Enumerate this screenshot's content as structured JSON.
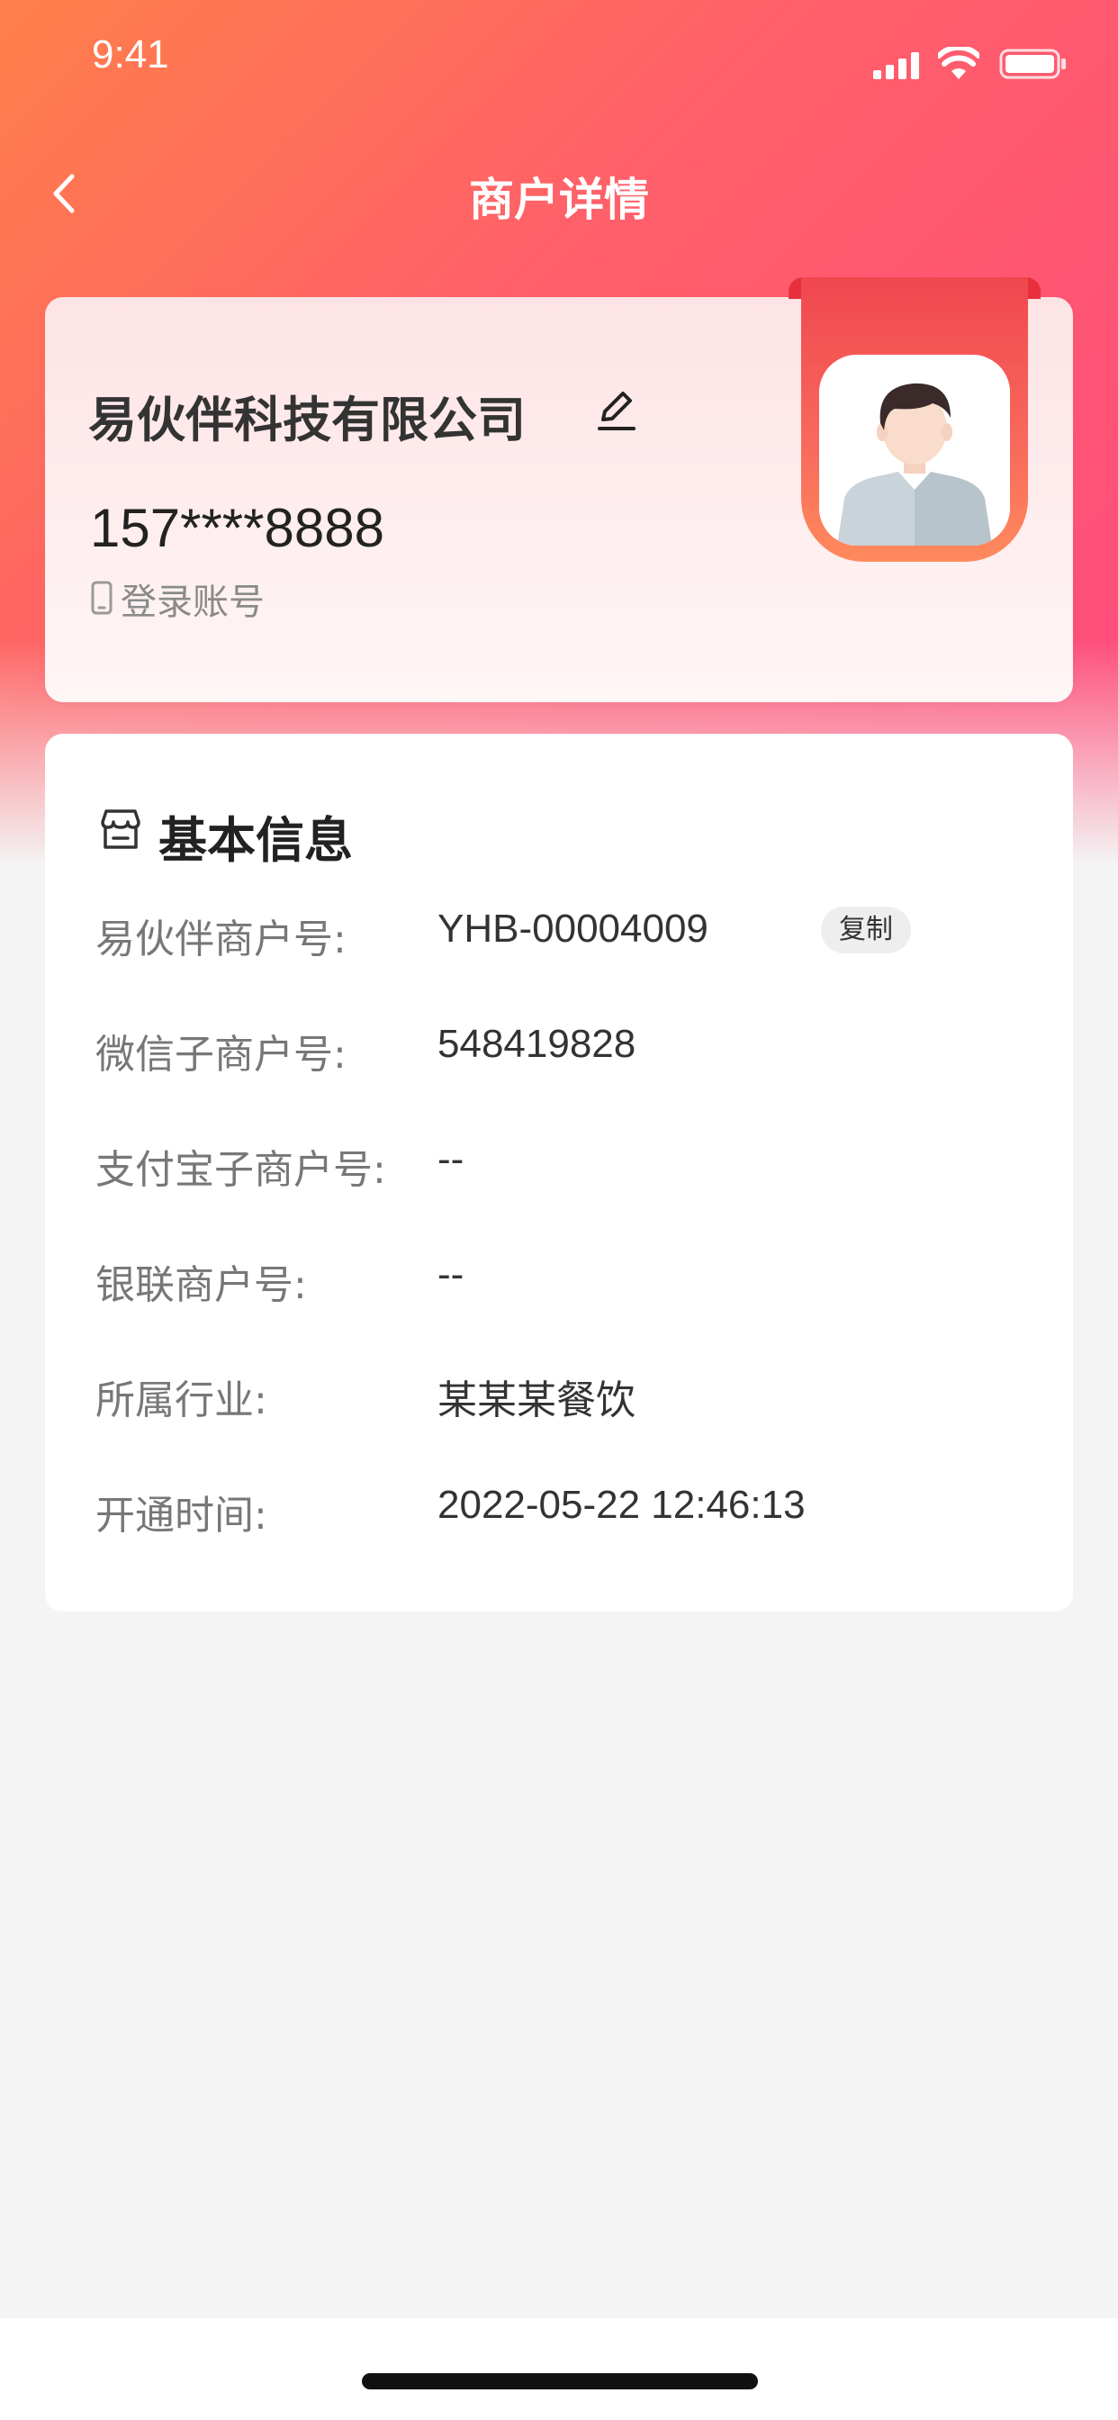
{
  "status_bar": {
    "time": "9:41"
  },
  "nav": {
    "title": "商户详情"
  },
  "profile": {
    "merchant_name": "易伙伴科技有限公司",
    "phone": "157****8888",
    "login_label": "登录账号"
  },
  "basic_info": {
    "title": "基本信息",
    "rows": [
      {
        "label": "易伙伴商户号:",
        "value": "YHB-00004009",
        "action": "复制"
      },
      {
        "label": "微信子商户号:",
        "value": "548419828"
      },
      {
        "label": "支付宝子商户号:",
        "value": "--"
      },
      {
        "label": "银联商户号:",
        "value": "--"
      },
      {
        "label": "所属行业:",
        "value": "某某某餐饮"
      },
      {
        "label": "开通时间:",
        "value": "2022-05-22 12:46:13"
      }
    ]
  },
  "colors": {
    "gradient_start": "#ff7f4a",
    "gradient_end": "#ff4b7e",
    "ribbon": "#f0474f",
    "text_primary": "#333333",
    "text_secondary": "#777777",
    "background": "#f4f4f4"
  },
  "icons": {
    "back": "chevron-left-icon",
    "edit": "pencil-icon",
    "phone": "phone-icon",
    "store": "store-icon",
    "avatar": "user-avatar"
  }
}
